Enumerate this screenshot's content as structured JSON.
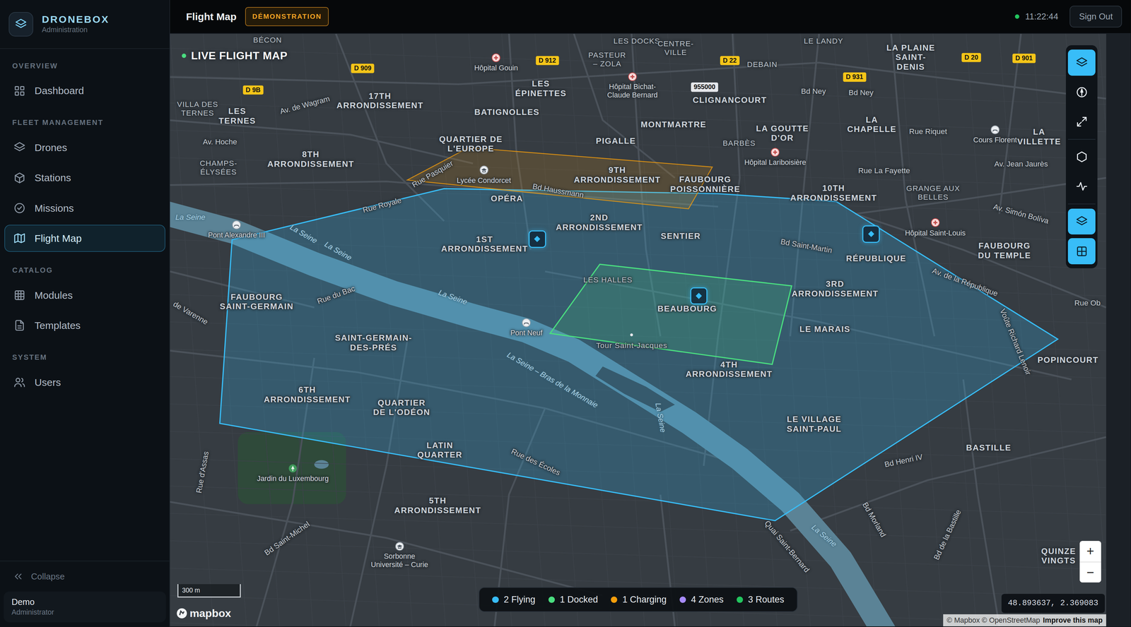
{
  "brand": {
    "name": "DRONEBOX",
    "subtitle": "Administration"
  },
  "sidebar": {
    "sections": [
      {
        "title": "OVERVIEW",
        "items": [
          {
            "label": "Dashboard",
            "selected": false
          }
        ]
      },
      {
        "title": "FLEET MANAGEMENT",
        "items": [
          {
            "label": "Drones",
            "selected": false
          },
          {
            "label": "Stations",
            "selected": false
          },
          {
            "label": "Missions",
            "selected": false
          },
          {
            "label": "Flight Map",
            "selected": true
          }
        ]
      },
      {
        "title": "CATALOG",
        "items": [
          {
            "label": "Modules",
            "selected": false
          },
          {
            "label": "Templates",
            "selected": false
          }
        ]
      },
      {
        "title": "SYSTEM",
        "items": [
          {
            "label": "Users",
            "selected": false
          }
        ]
      }
    ],
    "collapse": "Collapse",
    "user": {
      "name": "Demo",
      "role": "Administrator"
    }
  },
  "header": {
    "title": "Flight Map",
    "badge": "DÉMONSTRATION",
    "clock": "11:22:44",
    "live": true,
    "sign_out": "Sign Out"
  },
  "map": {
    "title": "LIVE FLIGHT MAP",
    "labels": [
      {
        "text": "BÉCON",
        "kind": "place"
      },
      {
        "text": "LES DOCKS",
        "kind": "place"
      },
      {
        "text": "CENTRE-\nVILLE",
        "kind": "place"
      },
      {
        "text": "LE LANDY",
        "kind": "place"
      },
      {
        "text": "LA PLAINE\nSAINT-\nDENIS",
        "kind": "district"
      },
      {
        "text": "Hôpital Gouin",
        "kind": "hospital"
      },
      {
        "text": "PASTEUR\n– ZOLA",
        "kind": "place"
      },
      {
        "text": "Hôpital Bichat-\nClaude Bernard",
        "kind": "hospital"
      },
      {
        "text": "LES\nÉPINETTES",
        "kind": "district"
      },
      {
        "text": "DEBAIN",
        "kind": "place"
      },
      {
        "text": "Bd Ney",
        "kind": "street"
      },
      {
        "text": "Bd Ney",
        "kind": "street"
      },
      {
        "text": "17TH\nARRONDISSEMENT",
        "kind": "district"
      },
      {
        "text": "BATIGNOLLES",
        "kind": "district"
      },
      {
        "text": "CLIGNANCOURT",
        "kind": "district"
      },
      {
        "text": "VILLA DES\nTERNES",
        "kind": "place"
      },
      {
        "text": "LES\nTERNES",
        "kind": "district"
      },
      {
        "text": "Av. de Wagram",
        "kind": "street"
      },
      {
        "text": "MONTMARTRE",
        "kind": "district"
      },
      {
        "text": "BARBÈS",
        "kind": "place"
      },
      {
        "text": "LA GOUTTE\nD'OR",
        "kind": "district"
      },
      {
        "text": "LA\nCHAPELLE",
        "kind": "district"
      },
      {
        "text": "Rue Riquet",
        "kind": "street"
      },
      {
        "text": "Cours Florent",
        "kind": "landmark"
      },
      {
        "text": "LA\nVILLETTE",
        "kind": "district"
      },
      {
        "text": "Av. Hoche",
        "kind": "street"
      },
      {
        "text": "8TH\nARRONDISSEMENT",
        "kind": "district"
      },
      {
        "text": "QUARTIER DE\nL'EUROPE",
        "kind": "district"
      },
      {
        "text": "PIGALLE",
        "kind": "district"
      },
      {
        "text": "Hôpital Lariboisière",
        "kind": "hospital"
      },
      {
        "text": "Rue La Fayette",
        "kind": "street"
      },
      {
        "text": "Av. Jean Jaurès",
        "kind": "street"
      },
      {
        "text": "CHAMPS-\nÉLYSÉES",
        "kind": "place"
      },
      {
        "text": "Lycée Condorcet",
        "kind": "school"
      },
      {
        "text": "Rue Pasquier",
        "kind": "street"
      },
      {
        "text": "Bd Haussmann",
        "kind": "street"
      },
      {
        "text": "9TH\nARRONDISSEMENT",
        "kind": "district"
      },
      {
        "text": "FAUBOURG\nPOISSONNIÈRE",
        "kind": "district"
      },
      {
        "text": "10TH\nARRONDISSEMENT",
        "kind": "district"
      },
      {
        "text": "GRANGE AUX\nBELLES",
        "kind": "place"
      },
      {
        "text": "Av. Simón Bolíva",
        "kind": "street"
      },
      {
        "text": "OPÉRA",
        "kind": "district"
      },
      {
        "text": "Rue Royale",
        "kind": "street"
      },
      {
        "text": "La Seine",
        "kind": "water"
      },
      {
        "text": "Pont Alexandre III",
        "kind": "landmark"
      },
      {
        "text": "2ND\nARRONDISSEMENT",
        "kind": "district"
      },
      {
        "text": "SENTIER",
        "kind": "district"
      },
      {
        "text": "1ST\nARRONDISSEMENT",
        "kind": "district"
      },
      {
        "text": "Hôpital Saint-Louis",
        "kind": "hospital"
      },
      {
        "text": "FAUBOURG\nDU TEMPLE",
        "kind": "district"
      },
      {
        "text": "Bd Saint-Martin",
        "kind": "street"
      },
      {
        "text": "RÉPUBLIQUE",
        "kind": "district"
      },
      {
        "text": "3RD\nARRONDISSEMENT",
        "kind": "district"
      },
      {
        "text": "Av. de la République",
        "kind": "street"
      },
      {
        "text": "Rue Ob",
        "kind": "street"
      },
      {
        "text": "LES HALLES",
        "kind": "place"
      },
      {
        "text": "BEAUBOURG",
        "kind": "district"
      },
      {
        "text": "La Seine",
        "kind": "water"
      },
      {
        "text": "La Seine",
        "kind": "water"
      },
      {
        "text": "La Seine",
        "kind": "water"
      },
      {
        "text": "Rue du Bac",
        "kind": "street"
      },
      {
        "text": "FAUBOURG\nSAINT-GERMAIN",
        "kind": "district"
      },
      {
        "text": "de Varenne",
        "kind": "street"
      },
      {
        "text": "Pont Neuf",
        "kind": "landmark"
      },
      {
        "text": "Tour Saint-Jacques",
        "kind": "place"
      },
      {
        "text": "LE MARAIS",
        "kind": "district"
      },
      {
        "text": "POPINCOURT",
        "kind": "district"
      },
      {
        "text": "SAINT-GERMAIN-\nDES-PRÉS",
        "kind": "district"
      },
      {
        "text": "4TH\nARRONDISSEMENT",
        "kind": "district"
      },
      {
        "text": "La Seine – Bras de la Monnaie",
        "kind": "water"
      },
      {
        "text": "La Seine",
        "kind": "water"
      },
      {
        "text": "Voûte Richard Lenoir",
        "kind": "street"
      },
      {
        "text": "6TH\nARRONDISSEMENT",
        "kind": "district"
      },
      {
        "text": "QUARTIER\nDE L'ODÉON",
        "kind": "district"
      },
      {
        "text": "LE VILLAGE\nSAINT-PAUL",
        "kind": "district"
      },
      {
        "text": "Rue d'Assas",
        "kind": "street"
      },
      {
        "text": "LATIN\nQUARTER",
        "kind": "district"
      },
      {
        "text": "Rue des Écoles",
        "kind": "street"
      },
      {
        "text": "Bd Henri IV",
        "kind": "street"
      },
      {
        "text": "BASTILLE",
        "kind": "district"
      },
      {
        "text": "Jardin du Luxembourg",
        "kind": "park"
      },
      {
        "text": "5TH\nARRONDISSEMENT",
        "kind": "district"
      },
      {
        "text": "Bd Morland",
        "kind": "street"
      },
      {
        "text": "Bd de la Bastille",
        "kind": "street"
      },
      {
        "text": "Quai Saint-Bernard",
        "kind": "street"
      },
      {
        "text": "La Seine",
        "kind": "water"
      },
      {
        "text": "Bd Saint-Michel",
        "kind": "street"
      },
      {
        "text": "Sorbonne\nUniversité – Curie",
        "kind": "school"
      },
      {
        "text": "QUINZE\nVINGTS",
        "kind": "district"
      },
      {
        "text": "D 9B",
        "kind": "road"
      },
      {
        "text": "D 909",
        "kind": "road"
      },
      {
        "text": "D 912",
        "kind": "road"
      },
      {
        "text": "D 22",
        "kind": "road"
      },
      {
        "text": "D 931",
        "kind": "road"
      },
      {
        "text": "D 20",
        "kind": "road"
      },
      {
        "text": "D 901",
        "kind": "road"
      },
      {
        "text": "955000",
        "kind": "route"
      }
    ],
    "tools": [
      [
        {
          "selected": true
        },
        {
          "selected": false
        },
        {
          "selected": false
        }
      ],
      [
        {
          "selected": false
        },
        {
          "selected": false
        }
      ],
      [
        {
          "selected": true
        },
        {
          "selected": true
        }
      ]
    ],
    "zoom": [
      "+",
      "−"
    ],
    "scale": "300 m",
    "logo": "mapbox",
    "coordinates": "48.893637, 2.369083",
    "attribution": {
      "text": "© Mapbox © OpenStreetMap",
      "link": "Improve this map"
    }
  },
  "legend": [
    {
      "label": "2 Flying",
      "color": "#38bdf8"
    },
    {
      "label": "1 Docked",
      "color": "#4ade80"
    },
    {
      "label": "1 Charging",
      "color": "#f59e0b"
    },
    {
      "label": "4 Zones",
      "color": "#a78bfa"
    },
    {
      "label": "3 Routes",
      "color": "#22c55e"
    }
  ]
}
